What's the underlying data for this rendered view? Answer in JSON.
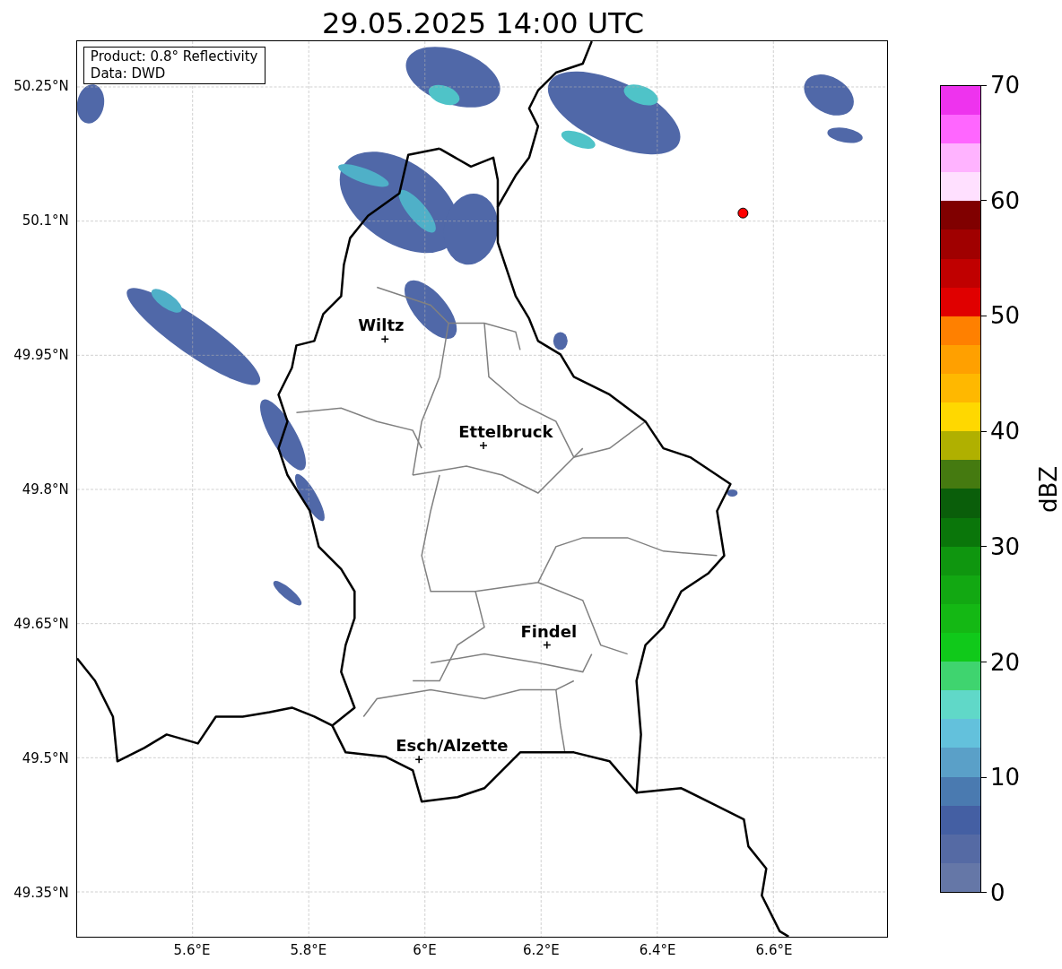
{
  "title": "29.05.2025 14:00 UTC",
  "info_box": {
    "lines": [
      "Product: 0.8° Reflectivity",
      "Data: DWD"
    ]
  },
  "map": {
    "lat_ticks": [
      "50.25°N",
      "50.1°N",
      "49.95°N",
      "49.8°N",
      "49.65°N",
      "49.5°N",
      "49.35°N"
    ],
    "lon_ticks": [
      "5.6°E",
      "5.8°E",
      "6°E",
      "6.2°E",
      "6.4°E",
      "6.6°E"
    ],
    "cities": [
      {
        "name": "Wiltz"
      },
      {
        "name": "Ettelbruck"
      },
      {
        "name": "Findel"
      },
      {
        "name": "Esch/Alzette"
      }
    ]
  },
  "colorbar": {
    "label": "dBZ",
    "ticks": [
      "70",
      "60",
      "50",
      "40",
      "30",
      "20",
      "10",
      "0"
    ],
    "segments": [
      {
        "color": "#6577a7"
      },
      {
        "color": "#556aa4"
      },
      {
        "color": "#445fa3"
      },
      {
        "color": "#4a7ab0"
      },
      {
        "color": "#5aa0c8"
      },
      {
        "color": "#63c1dc"
      },
      {
        "color": "#60d8c8"
      },
      {
        "color": "#3fd46f"
      },
      {
        "color": "#10c91a"
      },
      {
        "color": "#14b814"
      },
      {
        "color": "#12a812"
      },
      {
        "color": "#0f960f"
      },
      {
        "color": "#0a760a"
      },
      {
        "color": "#0a5e0a"
      },
      {
        "color": "#457a10"
      },
      {
        "color": "#b0b000"
      },
      {
        "color": "#ffd800"
      },
      {
        "color": "#ffb800"
      },
      {
        "color": "#ffa000"
      },
      {
        "color": "#ff8000"
      },
      {
        "color": "#e00000"
      },
      {
        "color": "#c00000"
      },
      {
        "color": "#a00000"
      },
      {
        "color": "#800000"
      },
      {
        "color": "#ffe0ff"
      },
      {
        "color": "#ffb3ff"
      },
      {
        "color": "#ff66ff"
      },
      {
        "color": "#ee33ee"
      }
    ]
  }
}
